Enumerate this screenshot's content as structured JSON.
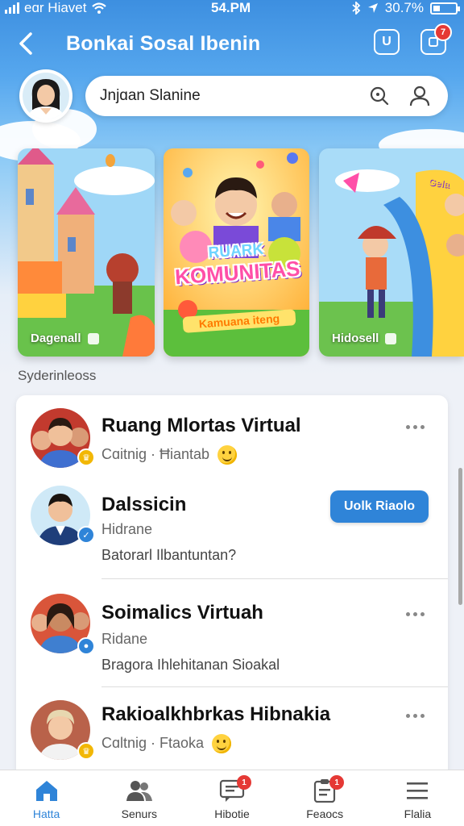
{
  "status_bar": {
    "carrier": "eɑr Ніаvеt",
    "time": "54.PM",
    "battery": "30.7%",
    "battery_fill": 0.3,
    "icons": [
      "signal-icon",
      "wifi-icon",
      "bluetooth-icon",
      "location-icon",
      "battery-icon"
    ]
  },
  "header": {
    "title": "Bonkai Sosal Ibenin",
    "square_button_label": "U",
    "notification_count": "7"
  },
  "search": {
    "value": "Jnjɑan Slanine",
    "placeholder": ""
  },
  "carousel": {
    "cards": [
      {
        "caption": "Dagenall"
      },
      {
        "banner_top": "RUARK",
        "banner_title": "KOMUNITAS",
        "banner_sub": "Kamuana iteng"
      },
      {
        "caption": "Hidosell",
        "sign_text": "Gela"
      }
    ]
  },
  "section_label": "Syderinleoss",
  "list": [
    {
      "name": "Ruang Mlortas Virtual",
      "subtitle": "Cɑitnig · Ħiantab",
      "has_emoji": true
    },
    {
      "name": "Dalssicin",
      "subtitle": "Hidrane",
      "description": "Batorarl Ilbantuntan?",
      "action_label": "Uolk Riaolo"
    },
    {
      "name": "Soimalics Virtuah",
      "subtitle": "Ridane",
      "description": "Bragora Ihlehitanan Sioakal"
    },
    {
      "name": "Rakioalkhbrkas Hibnakia",
      "subtitle": "Cɑltnig · Ftaoka",
      "has_emoji": true
    }
  ],
  "bottom_nav": [
    {
      "label": "Hatta",
      "icon": "home-icon",
      "active": true
    },
    {
      "label": "Senurs",
      "icon": "people-icon"
    },
    {
      "label": "Hibotie",
      "icon": "chat-icon",
      "badge": "1"
    },
    {
      "label": "Feaocs",
      "icon": "clipboard-icon",
      "badge": "1"
    },
    {
      "label": "Flalia",
      "icon": "menu-icon"
    }
  ],
  "colors": {
    "primary": "#2f84d8",
    "header_blue": "#3d8fe0",
    "badge_red": "#e53935",
    "online_yellow": "#f2b705"
  }
}
